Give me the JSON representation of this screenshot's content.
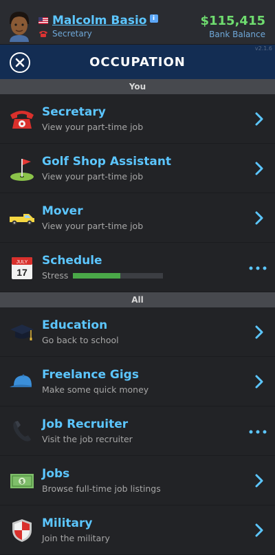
{
  "header": {
    "player_name": "Malcolm Basio",
    "info_badge": "i",
    "current_job": "Secretary",
    "balance": "$115,415",
    "balance_label": "Bank Balance",
    "version": "v2.1.6"
  },
  "titlebar": {
    "title": "OCCUPATION"
  },
  "sections": {
    "you": "You",
    "all": "All"
  },
  "you_items": [
    {
      "title": "Secretary",
      "subtitle": "View your part-time job",
      "icon": "telephone-icon"
    },
    {
      "title": "Golf Shop Assistant",
      "subtitle": "View your part-time job",
      "icon": "golf-flag-icon"
    },
    {
      "title": "Mover",
      "subtitle": "View your part-time job",
      "icon": "pickup-truck-icon"
    },
    {
      "title": "Schedule",
      "stress_label": "Stress",
      "stress_level": 0.52,
      "icon": "calendar-icon",
      "calendar_month": "JULY",
      "calendar_day": "17"
    }
  ],
  "all_items": [
    {
      "title": "Education",
      "subtitle": "Go back to school",
      "icon": "graduation-cap-icon"
    },
    {
      "title": "Freelance Gigs",
      "subtitle": "Make some quick money",
      "icon": "cap-icon"
    },
    {
      "title": "Job Recruiter",
      "subtitle": "Visit the job recruiter",
      "icon": "phone-receiver-icon"
    },
    {
      "title": "Jobs",
      "subtitle": "Browse full-time job listings",
      "icon": "money-icon"
    },
    {
      "title": "Military",
      "subtitle": "Join the military",
      "icon": "shield-icon"
    }
  ],
  "colors": {
    "accent": "#5cc6ff",
    "balance": "#6fdc6f",
    "titlebar": "#132d53",
    "stress": "#4aa848"
  }
}
